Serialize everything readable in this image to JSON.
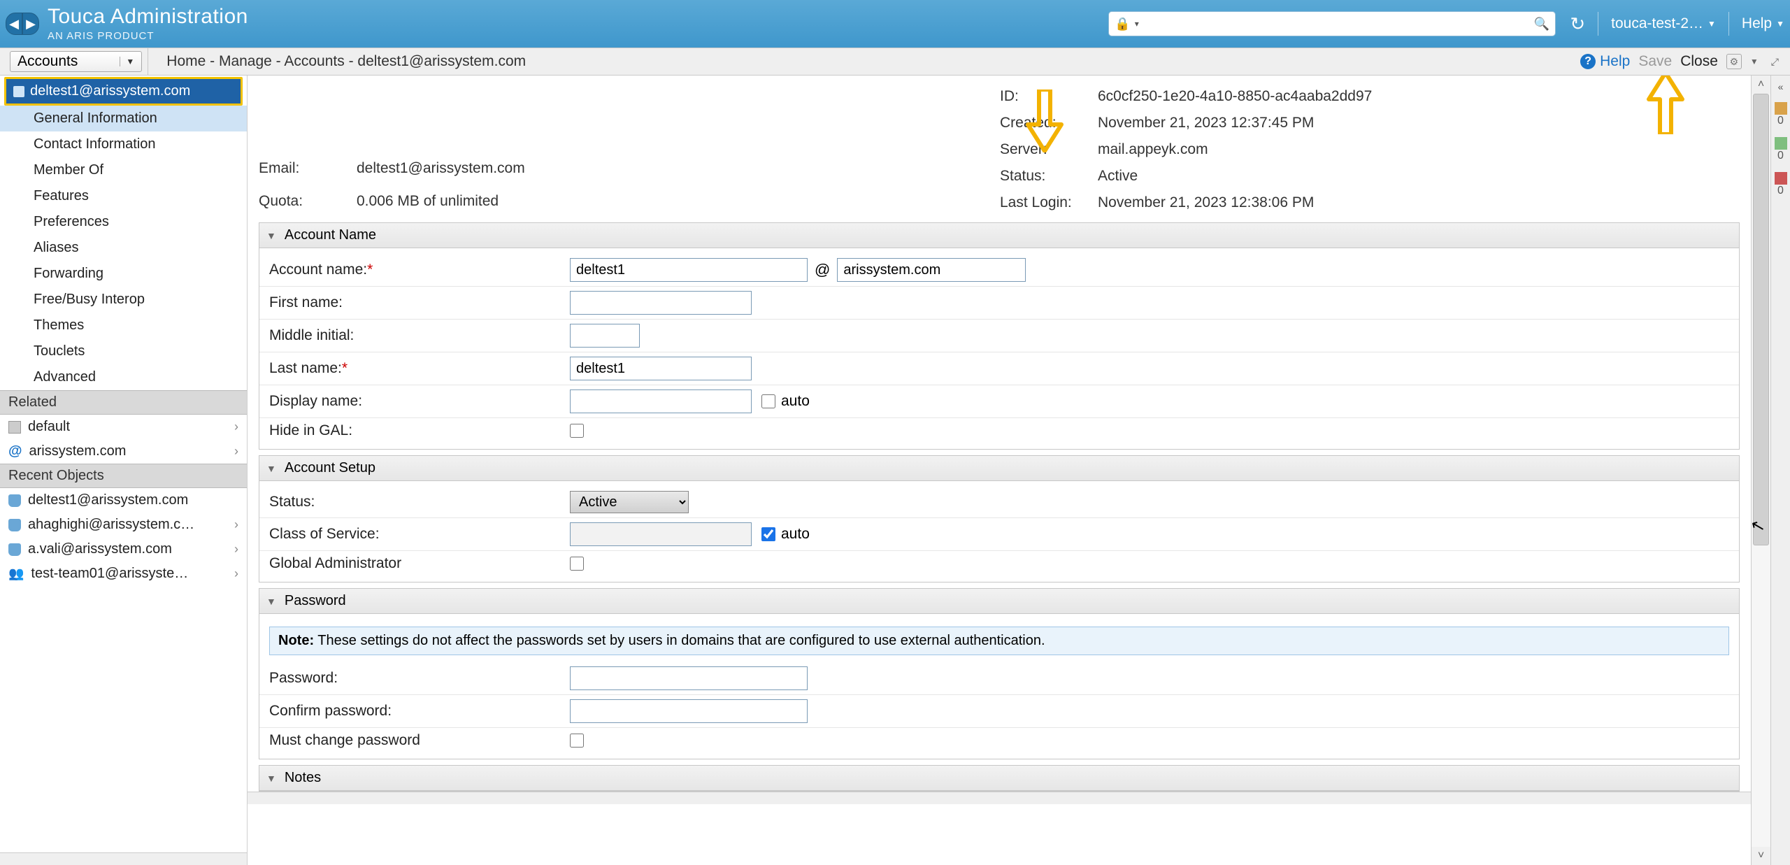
{
  "brand": {
    "title": "Touca Administration",
    "subtitle": "AN ARIS PRODUCT"
  },
  "topbar": {
    "search_placeholder": "",
    "user_label": "touca-test-2…",
    "help_label": "Help"
  },
  "subbar": {
    "dropdown_label": "Accounts",
    "breadcrumb": "Home - Manage - Accounts - deltest1@arissystem.com",
    "help": "Help",
    "save": "Save",
    "close": "Close"
  },
  "sidebar": {
    "account": "deltest1@arissystem.com",
    "nav": [
      "General Information",
      "Contact Information",
      "Member Of",
      "Features",
      "Preferences",
      "Aliases",
      "Forwarding",
      "Free/Busy Interop",
      "Themes",
      "Touclets",
      "Advanced"
    ],
    "related_header": "Related",
    "related": [
      {
        "icon": "file",
        "label": "default"
      },
      {
        "icon": "at",
        "label": "arissystem.com"
      }
    ],
    "recent_header": "Recent Objects",
    "recent": [
      {
        "icon": "user",
        "label": "deltest1@arissystem.com"
      },
      {
        "icon": "user",
        "label": "ahaghighi@arissystem.c…"
      },
      {
        "icon": "user",
        "label": "a.vali@arissystem.com"
      },
      {
        "icon": "grp",
        "label": "test-team01@arissyste…"
      }
    ]
  },
  "info": {
    "email_label": "Email:",
    "email": "deltest1@arissystem.com",
    "quota_label": "Quota:",
    "quota": "0.006 MB of unlimited",
    "id_label": "ID:",
    "id": "6c0cf250-1e20-4a10-8850-ac4aaba2dd97",
    "created_label": "Created:",
    "created": "November 21, 2023 12:37:45 PM",
    "server_label": "Server:",
    "server": "mail.appeyk.com",
    "status_label": "Status:",
    "status": "Active",
    "lastlogin_label": "Last Login:",
    "lastlogin": "November 21, 2023 12:38:06 PM"
  },
  "panels": {
    "account_name": {
      "title": "Account Name",
      "account_name_label": "Account name:",
      "account_name_value": "deltest1",
      "domain_value": "arissystem.com",
      "first_name_label": "First name:",
      "first_name_value": "",
      "middle_initial_label": "Middle initial:",
      "middle_initial_value": "",
      "last_name_label": "Last name:",
      "last_name_value": "deltest1",
      "display_name_label": "Display name:",
      "display_name_value": "",
      "auto_label": "auto",
      "hide_gal_label": "Hide in GAL:"
    },
    "account_setup": {
      "title": "Account Setup",
      "status_label": "Status:",
      "status_value": "Active",
      "cos_label": "Class of Service:",
      "cos_value": "",
      "auto_label": "auto",
      "gadmin_label": "Global Administrator"
    },
    "password": {
      "title": "Password",
      "note_prefix": "Note:",
      "note_text": " These settings do not affect the passwords set by users in domains that are configured to use external authentication.",
      "password_label": "Password:",
      "confirm_label": "Confirm password:",
      "must_change_label": "Must change password"
    },
    "notes": {
      "title": "Notes"
    }
  },
  "right_strip": {
    "c0": "0",
    "c1": "0",
    "c2": "0"
  }
}
